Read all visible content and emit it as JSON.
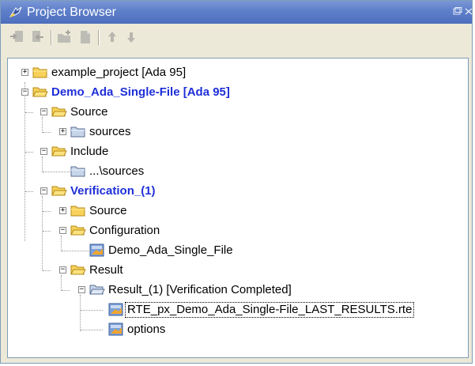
{
  "window": {
    "title": "Project Browser",
    "title_icon": "project-browser-icon",
    "controls": {
      "restore_icon": "restore-icon",
      "close_icon": "close-icon"
    }
  },
  "toolbar": {
    "buttons": [
      {
        "icon": "move-in-icon"
      },
      {
        "icon": "move-out-icon"
      },
      {
        "icon": "new-folder-icon"
      },
      {
        "icon": "new-file-icon"
      },
      {
        "icon": "arrow-up-icon"
      },
      {
        "icon": "arrow-down-icon"
      }
    ]
  },
  "tree": {
    "nodes": [
      {
        "label": "example_project [Ada 95]",
        "expander": "+",
        "icon": "folder-closed-icon",
        "bold": false,
        "selected": false
      },
      {
        "label": "Demo_Ada_Single-File [Ada 95]",
        "expander": "−",
        "icon": "folder-open-icon",
        "bold": true,
        "selected": false
      },
      {
        "label": "Source",
        "expander": "−",
        "icon": "folder-open-icon",
        "bold": false,
        "selected": false
      },
      {
        "label": "sources",
        "expander": "+",
        "icon": "folder-blue-icon",
        "bold": false,
        "selected": false
      },
      {
        "label": "Include",
        "expander": "−",
        "icon": "folder-open-icon",
        "bold": false,
        "selected": false
      },
      {
        "label": "...\\sources",
        "expander": "",
        "icon": "folder-blue-icon",
        "bold": false,
        "selected": false
      },
      {
        "label": "Verification_(1)",
        "expander": "−",
        "icon": "folder-open-icon",
        "bold": true,
        "selected": false
      },
      {
        "label": "Source",
        "expander": "+",
        "icon": "folder-closed-icon",
        "bold": false,
        "selected": false
      },
      {
        "label": "Configuration",
        "expander": "−",
        "icon": "folder-open-icon",
        "bold": false,
        "selected": false
      },
      {
        "label": "Demo_Ada_Single_File",
        "expander": "",
        "icon": "config-file-icon",
        "bold": false,
        "selected": false
      },
      {
        "label": "Result",
        "expander": "−",
        "icon": "folder-open-icon",
        "bold": false,
        "selected": false
      },
      {
        "label": "Result_(1) [Verification Completed]",
        "expander": "−",
        "icon": "folder-blue-open-icon",
        "bold": false,
        "selected": false
      },
      {
        "label": "RTE_px_Demo_Ada_Single-File_LAST_RESULTS.rte",
        "expander": "",
        "icon": "result-file-icon",
        "bold": false,
        "selected": true
      },
      {
        "label": "options",
        "expander": "",
        "icon": "options-file-icon",
        "bold": false,
        "selected": false
      }
    ]
  },
  "colors": {
    "titlebar": "#5d7ec9",
    "panel": "#ece9d8",
    "bold_node": "#1f2fd8",
    "folder": "#f7d15a"
  }
}
